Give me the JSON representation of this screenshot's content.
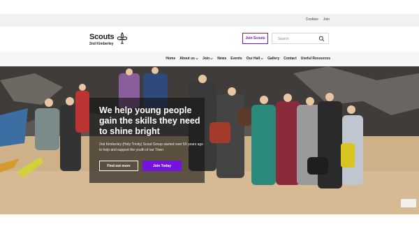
{
  "topbar": {
    "links": [
      "Cookies",
      "Join"
    ]
  },
  "header": {
    "logo_name": "Scouts",
    "logo_sub": "2nd Kimberley",
    "join_label": "Join Scouts",
    "search_placeholder": "Search"
  },
  "nav": {
    "items": [
      {
        "label": "Home"
      },
      {
        "label": "About us"
      },
      {
        "label": "Join"
      },
      {
        "label": "News"
      },
      {
        "label": "Events"
      },
      {
        "label": "Our Hall"
      },
      {
        "label": "Gallery"
      },
      {
        "label": "Contact"
      },
      {
        "label": "Useful Resources"
      }
    ]
  },
  "hero": {
    "heading": "We help young people gain the skills they need to shine bright",
    "body": "2nd Kimberley (Holy Trinity) Scout Group started over 50 years ago to help and support the youth of our Town",
    "btn_secondary": "Find out more",
    "btn_primary": "Join Today"
  },
  "colors": {
    "brand": "#7413dc",
    "overlay": "#141414"
  }
}
